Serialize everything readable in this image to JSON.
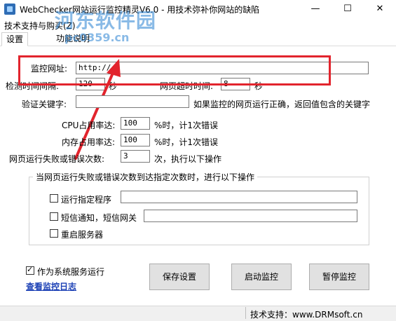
{
  "window": {
    "title": "WebChecker网站运行监控精灵V6.0 - 用技术弥补你网站的缺陷",
    "min_glyph": "—",
    "max_glyph": "☐",
    "close_glyph": "✕"
  },
  "watermark": {
    "text": "河东软件园",
    "url": "pc0359.cn"
  },
  "menu": {
    "items": [
      "技术支持与购买(Z)"
    ]
  },
  "tabs": [
    {
      "label": "设置"
    },
    {
      "label": "功能说明"
    }
  ],
  "form": {
    "url_label": "监控网址:",
    "url_value": "http://",
    "interval_label": "检测时间间隔:",
    "interval_value": "120",
    "interval_unit": "秒",
    "timeout_label": "网页超时时间:",
    "timeout_value": "8",
    "timeout_unit": "秒",
    "keyword_label": "验证关键字:",
    "keyword_value": "",
    "keyword_hint": "如果监控的网页运行正确，返回值包含的关键字",
    "cpu_label": "CPU占用率达:",
    "cpu_value": "100",
    "cpu_hint": "%时，计1次错误",
    "mem_label": "内存占用率达:",
    "mem_value": "100",
    "mem_hint": "%时，计1次错误",
    "fail_label": "网页运行失败或错误次数:",
    "fail_value": "3",
    "fail_hint": "次，执行以下操作"
  },
  "actions_group": {
    "title": "当网页运行失败或错误次数到达指定次数时，进行以下操作",
    "run_program_label": "运行指定程序",
    "run_program_checked": false,
    "run_program_value": "",
    "sms_label": "短信通知，短信网关",
    "sms_checked": false,
    "sms_value": "",
    "restart_label": "重启服务器",
    "restart_checked": false
  },
  "bottom": {
    "service_label": "作为系统服务运行",
    "service_checked": true,
    "log_link": "查看监控日志",
    "save_button": "保存设置",
    "start_button": "启动监控",
    "pause_button": "暂停监控"
  },
  "status": {
    "support": "技术支持：www.DRMsoft.cn"
  },
  "colors": {
    "annotation_red": "#e2242d",
    "link_blue": "#1a3fb5"
  }
}
